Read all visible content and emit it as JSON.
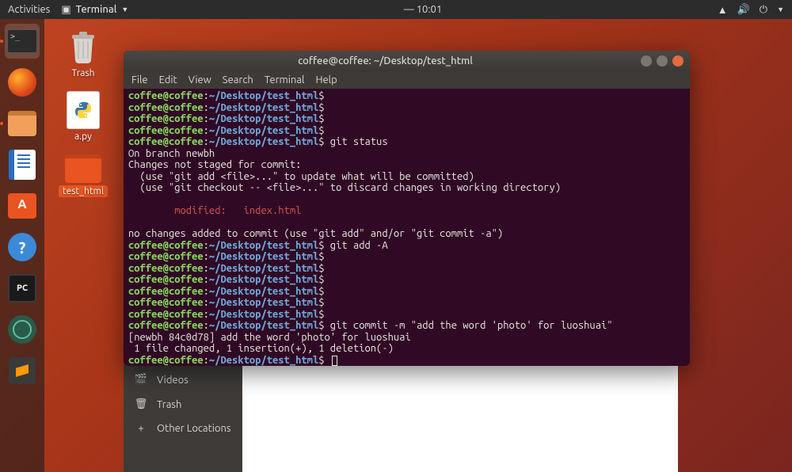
{
  "topbar": {
    "activities": "Activities",
    "app_label": "Terminal",
    "clock": "10:01"
  },
  "desktop": {
    "trash": "Trash",
    "py_file": "a.py",
    "folder": "test_html"
  },
  "files_sidebar": {
    "videos": "Videos",
    "trash": "Trash",
    "other": "Other Locations"
  },
  "terminal": {
    "title": "coffee@coffee: ~/Desktop/test_html",
    "menu": {
      "file": "File",
      "edit": "Edit",
      "view": "View",
      "search": "Search",
      "terminal": "Terminal",
      "help": "Help"
    },
    "prompt": {
      "userhost": "coffee@coffee",
      "sep": ":",
      "path": "~/Desktop/test_html",
      "sym": "$"
    },
    "cmds": {
      "empty": "",
      "git_status": " git status",
      "git_add": " git add -A",
      "git_commit": " git commit -m \"add the word 'photo' for luoshuai\""
    },
    "out": {
      "branch": "On branch newbh",
      "not_staged": "Changes not staged for commit:",
      "hint_add": "  (use \"git add <file>...\" to update what will be committed)",
      "hint_checkout": "  (use \"git checkout -- <file>...\" to discard changes in working directory)",
      "modified": "        modified:   index.html",
      "no_changes": "no changes added to commit (use \"git add\" and/or \"git commit -a\")",
      "commit_res1": "[newbh 84c0d78] add the word 'photo' for luoshuai",
      "commit_res2": " 1 file changed, 1 insertion(+), 1 deletion(-)"
    }
  }
}
